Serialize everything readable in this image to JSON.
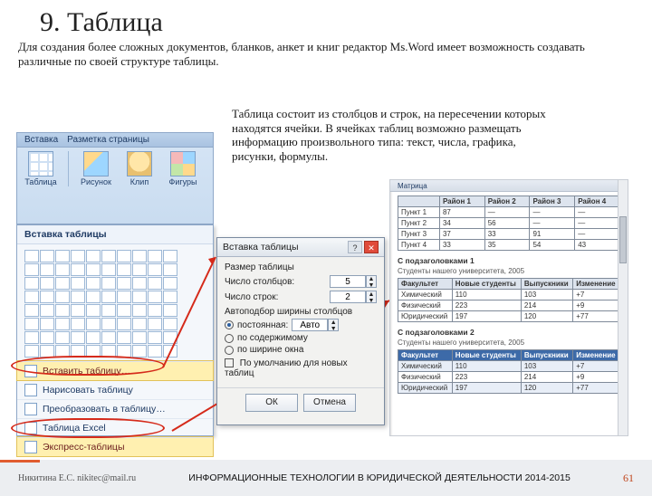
{
  "heading": "9. Таблица",
  "subtitle": "Для создания более сложных документов, бланков, анкет и книг редактор Ms.Word имеет возможность создавать различные по своей структуре таблицы.",
  "caption": "Таблица состоит из столбцов и строк, на пересечении которых находятся ячейки. В ячейках таблиц возможно размещать информацию произвольного типа: текст, числа, графика, рисунки, формулы.",
  "ribbon": {
    "tabs": [
      "Вставка",
      "Разметка страницы"
    ],
    "buttons": {
      "table": "Таблица",
      "picture": "Рисунок",
      "clip": "Клип",
      "shapes": "Фигуры"
    }
  },
  "dropdown": {
    "header": "Вставка таблицы",
    "items": [
      "Вставить таблицу…",
      "Нарисовать таблицу",
      "Преобразовать в таблицу…",
      "Таблица Excel",
      "Экспресс-таблицы"
    ]
  },
  "dialog": {
    "title": "Вставка таблицы",
    "g1": "Размер таблицы",
    "cols_lbl": "Число столбцов:",
    "cols_val": "5",
    "rows_lbl": "Число строк:",
    "rows_val": "2",
    "g2": "Автоподбор ширины столбцов",
    "r1": "постоянная:",
    "r1v": "Авто",
    "r2": "по содержимому",
    "r3": "по ширине окна",
    "chk": "По умолчанию для новых таблиц",
    "ok": "ОК",
    "cancel": "Отмена"
  },
  "doc": {
    "toplabel": "Матрица",
    "t1_head": [
      "",
      "Район 1",
      "Район 2",
      "Район 3",
      "Район 4"
    ],
    "t1_rows": [
      [
        "Пункт 1",
        "87",
        "—",
        "—",
        "—"
      ],
      [
        "Пункт 2",
        "34",
        "56",
        "—",
        "—"
      ],
      [
        "Пункт 3",
        "37",
        "33",
        "91",
        "—"
      ],
      [
        "Пункт 4",
        "33",
        "35",
        "54",
        "43"
      ]
    ],
    "h1": "С подзаголовками 1",
    "cap1": "Студенты нашего университета, 2005",
    "t2_head": [
      "Факультет",
      "Новые студенты",
      "Выпускники",
      "Изменение"
    ],
    "t2_rows": [
      [
        "Химический",
        "110",
        "103",
        "+7"
      ],
      [
        "Физический",
        "223",
        "214",
        "+9"
      ],
      [
        "Юридический",
        "197",
        "120",
        "+77"
      ]
    ],
    "h2": "С подзаголовками 2",
    "cap2": "Студенты нашего университета, 2005",
    "t3_head": [
      "Факультет",
      "Новые студенты",
      "Выпускники",
      "Изменение"
    ],
    "t3_rows": [
      [
        "Химический",
        "110",
        "103",
        "+7"
      ],
      [
        "Физический",
        "223",
        "214",
        "+9"
      ],
      [
        "Юридический",
        "197",
        "120",
        "+77"
      ]
    ]
  },
  "footer": {
    "left": "Никитина Е.С. nikitec@mail.ru",
    "mid": "ИНФОРМАЦИОННЫЕ ТЕХНОЛОГИИ В ЮРИДИЧЕСКОЙ ДЕЯТЕЛЬНОСТИ 2014-2015",
    "page": "61"
  }
}
